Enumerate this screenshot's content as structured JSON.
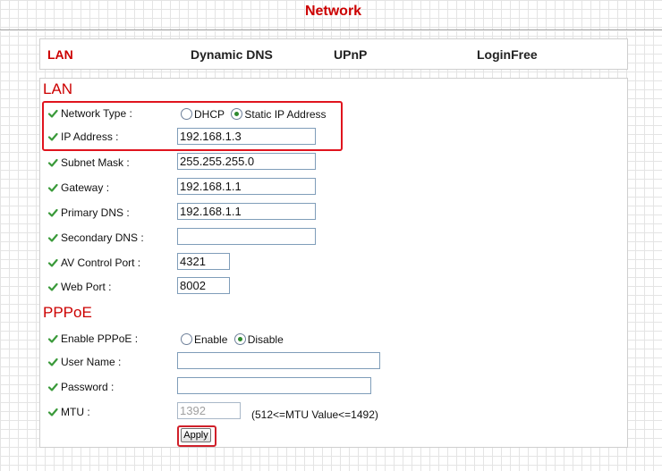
{
  "page": {
    "title": "Network"
  },
  "tabs": [
    {
      "label": "LAN",
      "active": true
    },
    {
      "label": "Dynamic DNS",
      "active": false
    },
    {
      "label": "UPnP",
      "active": false
    },
    {
      "label": "LoginFree",
      "active": false
    }
  ],
  "lan": {
    "heading": "LAN",
    "network_type": {
      "label": "Network Type :",
      "options": [
        "DHCP",
        "Static IP Address"
      ],
      "selected": "Static IP Address"
    },
    "fields": {
      "ip_address": {
        "label": "IP Address :",
        "value": "192.168.1.3"
      },
      "subnet_mask": {
        "label": "Subnet Mask :",
        "value": "255.255.255.0"
      },
      "gateway": {
        "label": "Gateway :",
        "value": "192.168.1.1"
      },
      "primary_dns": {
        "label": "Primary DNS :",
        "value": "192.168.1.1"
      },
      "secondary_dns": {
        "label": "Secondary DNS :",
        "value": ""
      },
      "av_control_port": {
        "label": "AV Control Port :",
        "value": "4321"
      },
      "web_port": {
        "label": "Web Port :",
        "value": "8002"
      }
    }
  },
  "pppoe": {
    "heading": "PPPoE",
    "enable": {
      "label": "Enable PPPoE :",
      "options": [
        "Enable",
        "Disable"
      ],
      "selected": "Disable"
    },
    "user_name": {
      "label": "User Name :",
      "value": ""
    },
    "password": {
      "label": "Password :",
      "value": ""
    },
    "mtu": {
      "label": "MTU :",
      "value": "1392",
      "hint": "(512<=MTU Value<=1492)",
      "disabled": true
    }
  },
  "buttons": {
    "apply": "Apply"
  },
  "colors": {
    "accent": "#cc0000",
    "highlight": "#e0141e",
    "check": "#3a9a3a"
  }
}
